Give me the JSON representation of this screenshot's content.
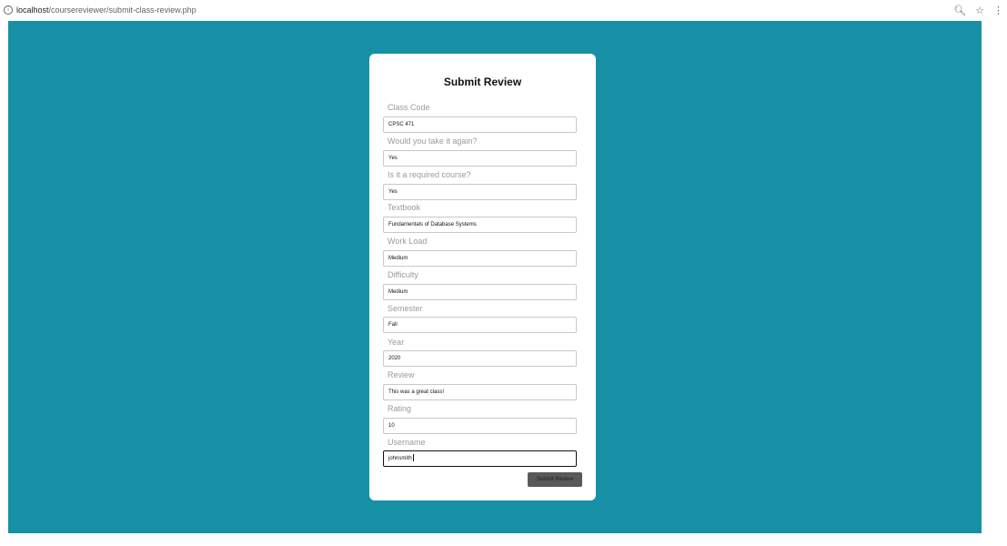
{
  "browser": {
    "url_host": "localhost",
    "url_path": "/coursereviewer/submit-class-review.php"
  },
  "form": {
    "title": "Submit Review",
    "fields": [
      {
        "label": "Class Code",
        "value": "CPSC 471"
      },
      {
        "label": "Would you take it again?",
        "value": "Yes"
      },
      {
        "label": "Is it a required course?",
        "value": "Yes"
      },
      {
        "label": "Textbook",
        "value": "Fundamentals of Database Systems"
      },
      {
        "label": "Work Load",
        "value": "Medium"
      },
      {
        "label": "Difficulty",
        "value": "Medium"
      },
      {
        "label": "Semester",
        "value": "Fall"
      },
      {
        "label": "Year",
        "value": "2020"
      },
      {
        "label": "Review",
        "value": "This was a great class!"
      },
      {
        "label": "Rating",
        "value": "10"
      },
      {
        "label": "Username",
        "value": "johnsmith"
      }
    ],
    "submit_label": "Submit Review"
  },
  "colors": {
    "page_background": "#1790a6",
    "card_background": "#ffffff",
    "button_background": "#595959"
  }
}
